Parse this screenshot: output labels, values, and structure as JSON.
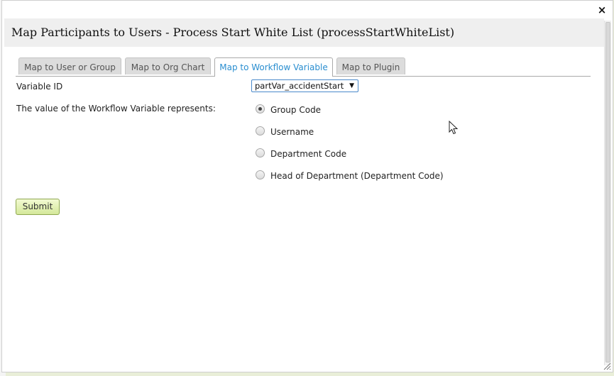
{
  "dialog": {
    "title": "Map Participants to Users - Process Start White List (processStartWhiteList)",
    "close_label": "×"
  },
  "tabs": [
    {
      "label": "Map to User or Group",
      "active": false
    },
    {
      "label": "Map to Org Chart",
      "active": false
    },
    {
      "label": "Map to Workflow Variable",
      "active": true
    },
    {
      "label": "Map to Plugin",
      "active": false
    }
  ],
  "form": {
    "variable_id_label": "Variable ID",
    "variable_id_value": "partVar_accidentStart",
    "represents_label": "The value of the Workflow Variable represents:",
    "options": [
      {
        "label": "Group Code",
        "selected": true
      },
      {
        "label": "Username",
        "selected": false
      },
      {
        "label": "Department Code",
        "selected": false
      },
      {
        "label": "Head of Department (Department Code)",
        "selected": false
      }
    ],
    "submit_label": "Submit"
  },
  "icons": {
    "close": "close-icon",
    "dropdown": "dropdown-arrow-icon",
    "resize": "resize-grip-icon",
    "cursor": "mouse-pointer-icon"
  },
  "colors": {
    "active_tab_text": "#2a8ed0",
    "submit_bg": "#d4e89a",
    "page_bg": "#e9eed8"
  }
}
